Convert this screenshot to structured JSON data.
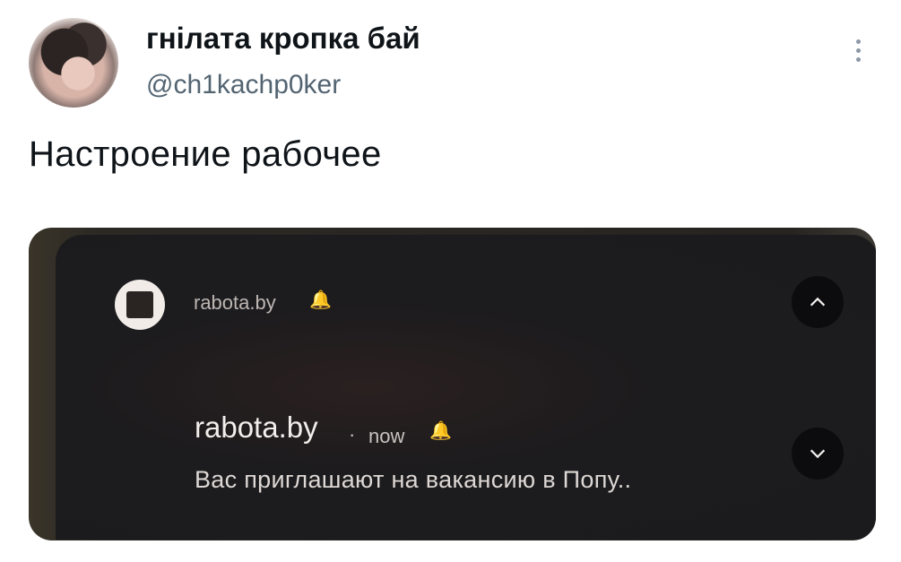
{
  "tweet": {
    "display_name": "гнілата кропка бай",
    "handle": "@ch1kachp0ker",
    "text": "Настроение рабочее",
    "more_icon": "more-vertical-icon"
  },
  "notification": {
    "app_name": "rabota.by",
    "title": "rabota.by",
    "separator": "·",
    "time": "now",
    "body": "Вас приглашают на вакансию в Попу..",
    "icons": {
      "app": "app-square-icon",
      "bell": "bell-icon",
      "collapse": "chevron-up-icon",
      "expand": "chevron-down-icon"
    }
  }
}
